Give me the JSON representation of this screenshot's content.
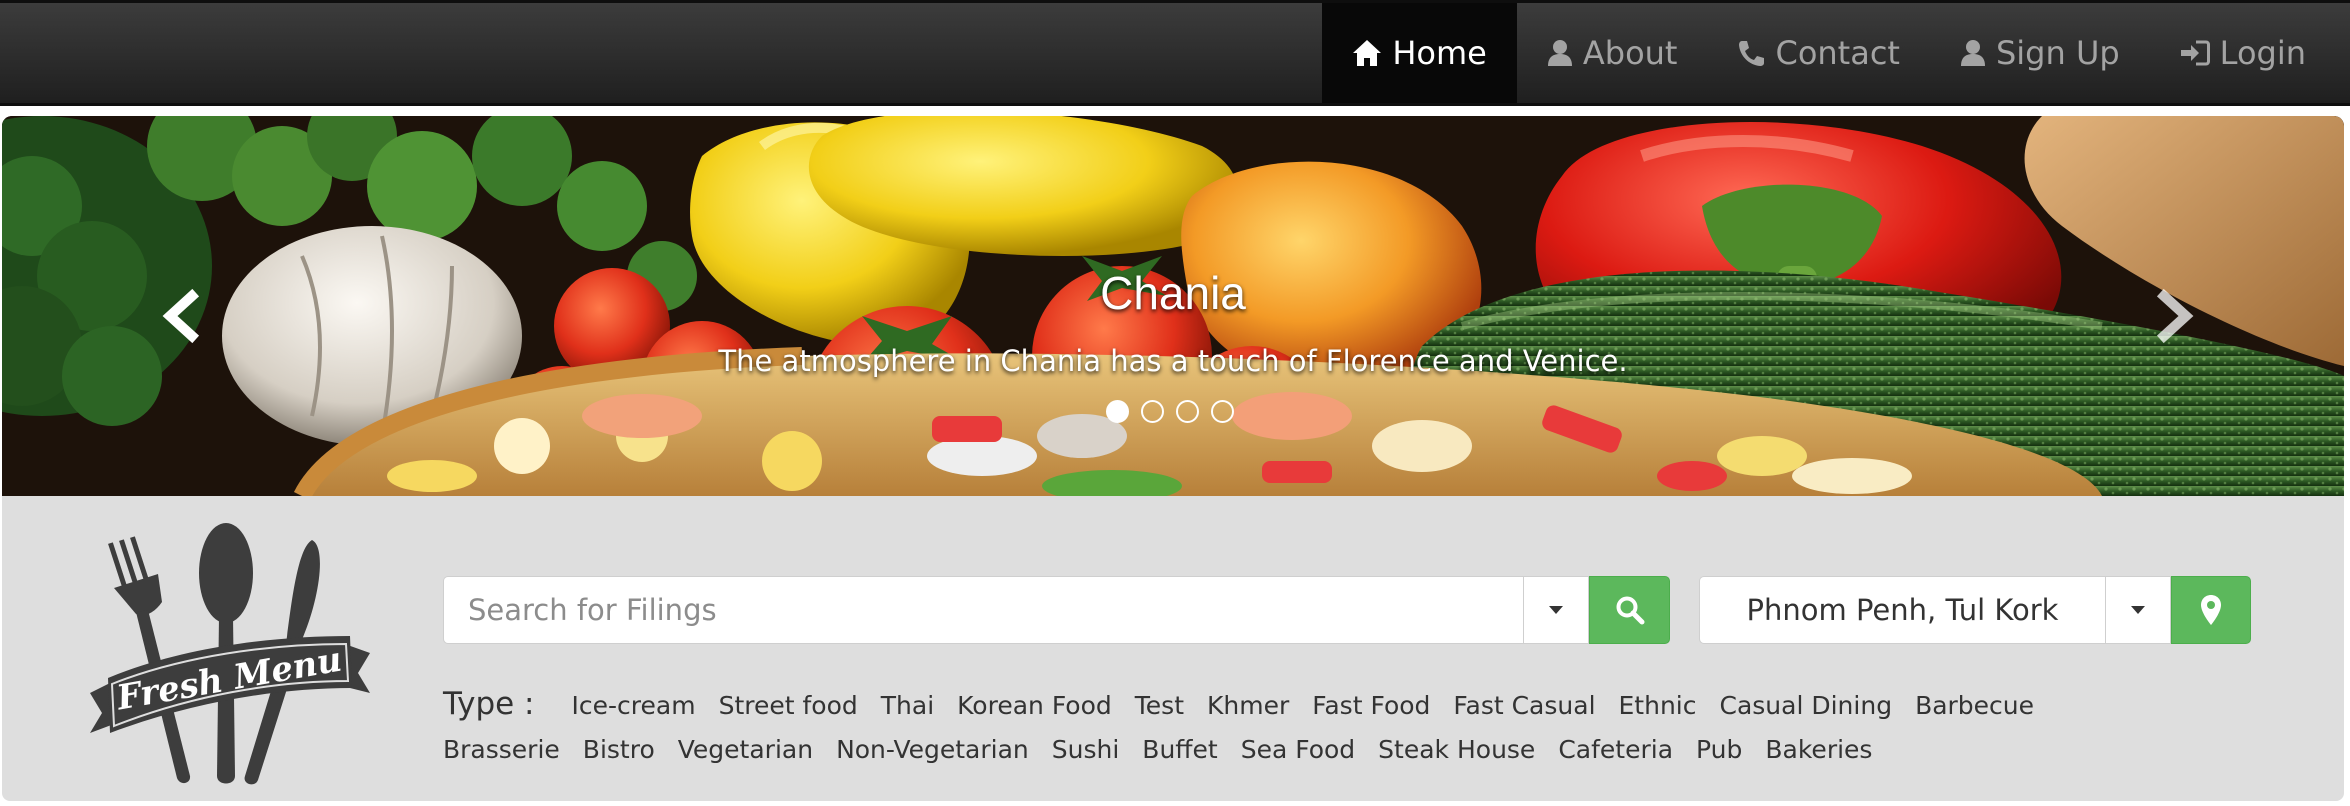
{
  "nav": {
    "items": [
      {
        "label": "Home",
        "icon": "home-icon",
        "active": true
      },
      {
        "label": "About",
        "icon": "user-icon",
        "active": false
      },
      {
        "label": "Contact",
        "icon": "phone-icon",
        "active": false
      },
      {
        "label": "Sign Up",
        "icon": "user-icon",
        "active": false
      },
      {
        "label": "Login",
        "icon": "login-icon",
        "active": false
      }
    ]
  },
  "carousel": {
    "title": "Chania",
    "description": "The atmosphere in Chania has a touch of Florence and Venice.",
    "slide_count": 4,
    "active_index": 0
  },
  "logo": {
    "text": "Fresh Menu"
  },
  "search": {
    "placeholder": "Search for Filings",
    "value": ""
  },
  "location": {
    "value": "Phnom Penh, Tul Kork"
  },
  "types": {
    "label": "Type :",
    "items": [
      "Ice-cream",
      "Street food",
      "Thai",
      "Korean Food",
      "Test",
      "Khmer",
      "Fast Food",
      "Fast Casual",
      "Ethnic",
      "Casual Dining",
      "Barbecue",
      "Brasserie",
      "Bistro",
      "Vegetarian",
      "Non-Vegetarian",
      "Sushi",
      "Buffet",
      "Sea Food",
      "Steak House",
      "Cafeteria",
      "Pub",
      "Bakeries"
    ]
  },
  "colors": {
    "navbar": "#2b2b2b",
    "nav_active": "#080808",
    "button_green": "#5cb85c",
    "panel": "#dedede"
  }
}
